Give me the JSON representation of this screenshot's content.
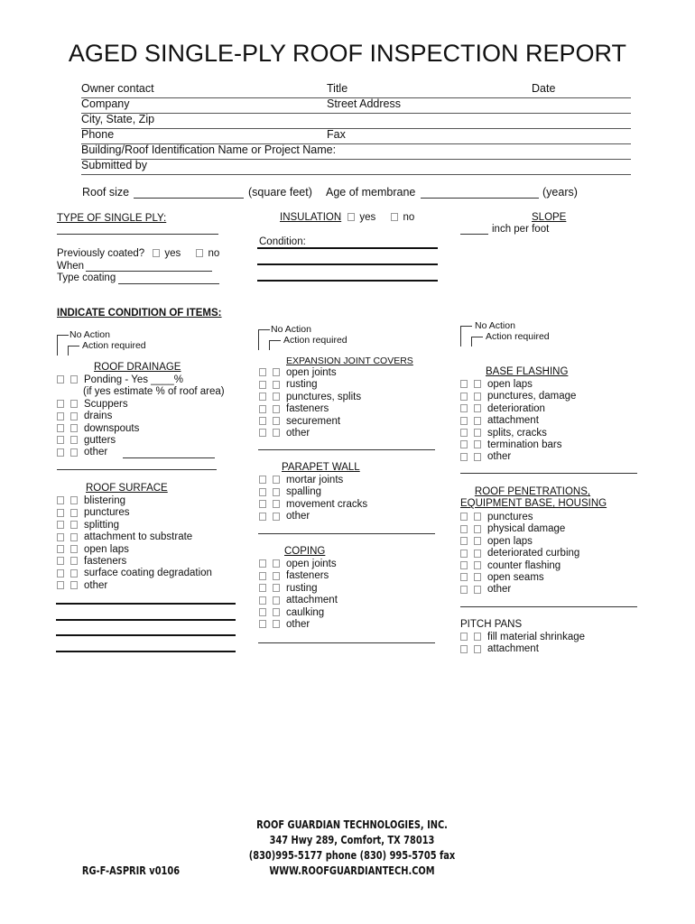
{
  "title": "AGED SINGLE-PLY ROOF INSPECTION REPORT",
  "header_fields": [
    {
      "left": "Owner contact",
      "mid": "Title",
      "right": "Date"
    },
    {
      "left": "Company",
      "mid": "Street Address",
      "right": ""
    },
    {
      "left": "City, State, Zip",
      "mid": "",
      "right": ""
    },
    {
      "left": "Phone",
      "mid": "Fax",
      "right": ""
    },
    {
      "left": "Building/Roof Identification Name or Project Name:",
      "mid": "",
      "right": ""
    },
    {
      "left": "Submitted by",
      "mid": "",
      "right": ""
    }
  ],
  "roof_size": {
    "label": "Roof size",
    "unit": "(square feet)",
    "age_label": "Age of membrane",
    "age_unit": "(years)"
  },
  "type_single_ply": {
    "label": "TYPE OF SINGLE PLY:"
  },
  "previously_coated": {
    "label": "Previously coated?",
    "yes": "yes",
    "no": "no",
    "when": "When",
    "type_coating": "Type coating"
  },
  "insulation": {
    "label": "INSULATION",
    "yes": "yes",
    "no": "no",
    "condition": "Condition:"
  },
  "slope": {
    "label": "SLOPE",
    "unit": "inch per foot"
  },
  "indicate": "INDICATE CONDITION OF ITEMS:",
  "legend": {
    "no_action": "No Action",
    "action_required": "Action required"
  },
  "sections": {
    "roof_drainage": {
      "title": "ROOF DRAINAGE",
      "items": [
        "Ponding  - Yes ____%",
        "Scuppers",
        "drains",
        "downspouts",
        "gutters",
        "other"
      ],
      "note": "(if yes estimate % of roof area)"
    },
    "roof_surface": {
      "title": "ROOF SURFACE",
      "items": [
        "blistering",
        "punctures",
        "splitting",
        "attachment to substrate",
        "open laps",
        "fasteners",
        "surface coating degradation",
        "other"
      ]
    },
    "expansion_joint_covers": {
      "title": "EXPANSION JOINT COVERS",
      "items": [
        "open joints",
        "rusting",
        "punctures, splits",
        "fasteners",
        "securement",
        "other"
      ]
    },
    "parapet_wall": {
      "title": "PARAPET WALL",
      "items": [
        "mortar joints",
        "spalling",
        "movement cracks",
        "other"
      ]
    },
    "coping": {
      "title": "COPING",
      "items": [
        "open joints",
        "fasteners",
        "rusting",
        "attachment",
        "caulking",
        "other"
      ]
    },
    "base_flashing": {
      "title": "BASE FLASHING",
      "items": [
        "open laps",
        "punctures, damage",
        "deterioration",
        "attachment",
        "splits, cracks",
        "termination bars",
        "other"
      ]
    },
    "roof_penetrations": {
      "title_line1": "ROOF PENETRATIONS,",
      "title_line2": "EQUIPMENT BASE, HOUSING",
      "items": [
        "punctures",
        "physical damage",
        "open laps",
        "deteriorated curbing",
        "counter flashing",
        "open seams",
        "other"
      ]
    },
    "pitch_pans": {
      "title": "PITCH PANS",
      "items": [
        "fill material shrinkage",
        "attachment"
      ]
    }
  },
  "footer": {
    "form_id": "RG-F-ASPRIR v0106",
    "company": "ROOF GUARDIAN TECHNOLOGIES, INC.",
    "address": "347 Hwy 289, Comfort, TX 78013",
    "phone": "(830)995-5177 phone (830) 995-5705 fax",
    "website": "WWW.ROOFGUARDIANTECH.COM"
  }
}
